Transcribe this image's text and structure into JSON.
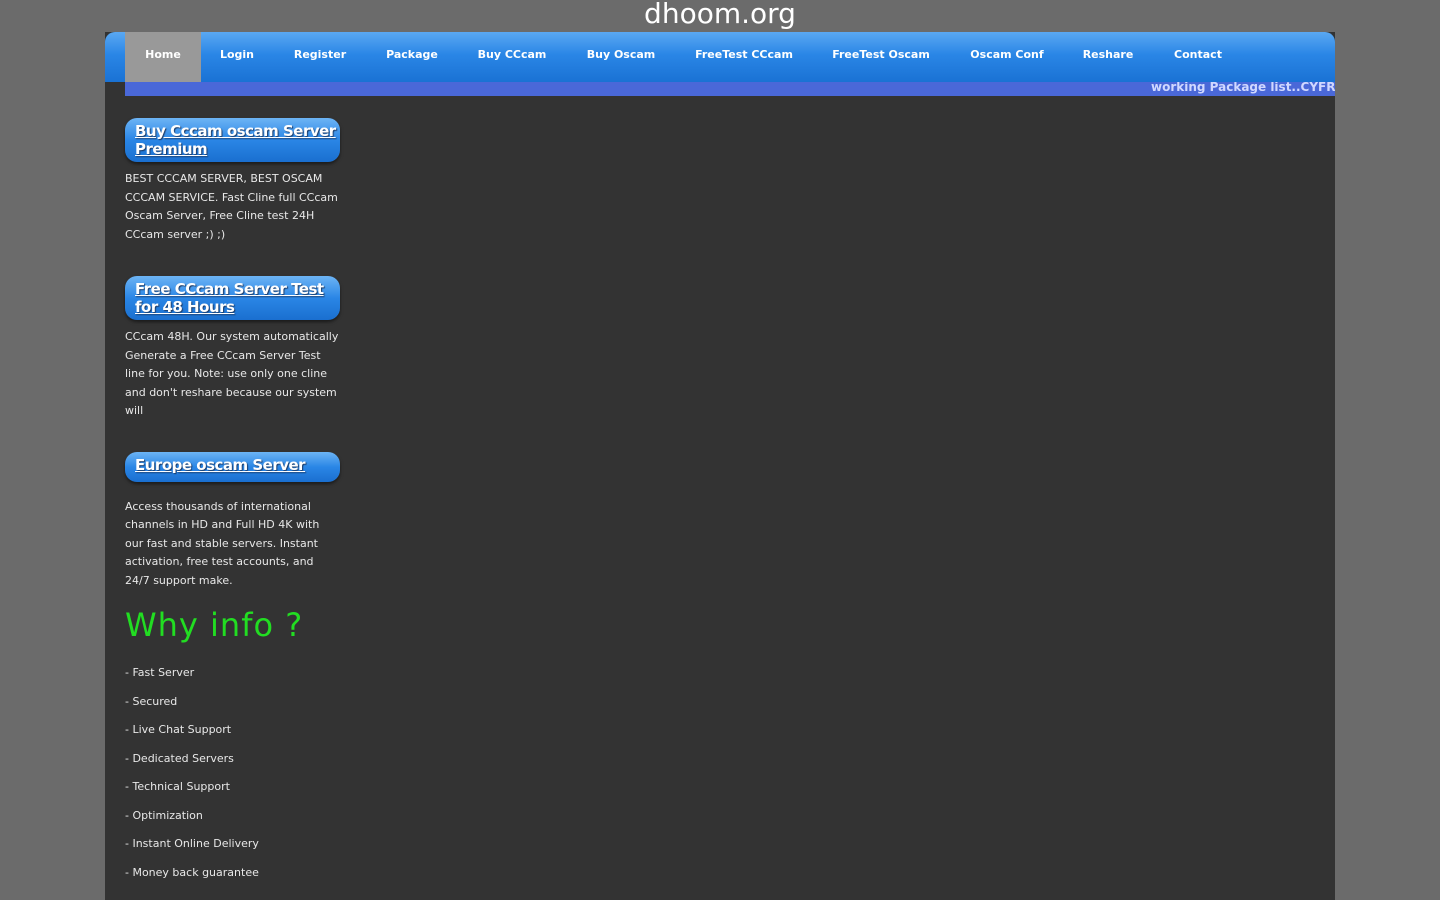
{
  "site": {
    "title": "dhoom.org"
  },
  "nav": {
    "items": [
      {
        "label": "Home",
        "active": true
      },
      {
        "label": "Login"
      },
      {
        "label": "Register"
      },
      {
        "label": "Package"
      },
      {
        "label": "Buy CCcam"
      },
      {
        "label": "Buy Oscam"
      },
      {
        "label": "FreeTest CCcam"
      },
      {
        "label": "FreeTest Oscam"
      },
      {
        "label": "Oscam Conf"
      },
      {
        "label": "Reshare"
      },
      {
        "label": "Contact"
      }
    ]
  },
  "ticker": {
    "text": "working Package list..CYFR"
  },
  "sidebar": {
    "boxes": [
      {
        "title": "Buy Cccam oscam Server Premium",
        "desc": "BEST CCCAM SERVER, BEST OSCAM CCCAM SERVICE. Fast Cline full CCcam Oscam Server, Free Cline test 24H CCcam server ;) ;)"
      },
      {
        "title": "Free CCcam Server Test for 48 Hours",
        "desc": "CCcam 48H. Our system automatically Generate a Free CCcam Server Test line for you. Note: use only one cline and don't reshare because our system will"
      },
      {
        "title": "Europe oscam Server",
        "desc": "Access thousands of international channels in HD and Full HD 4K with our fast and stable servers. Instant activation, free test accounts, and 24/7 support make."
      }
    ]
  },
  "why": {
    "heading": "Why info ?",
    "items": [
      "- Fast Server",
      "- Secured",
      "- Live Chat Support",
      "- Dedicated Servers",
      "- Technical Support",
      "- Optimization",
      "- Instant Online Delivery",
      "- Money back guarantee"
    ]
  },
  "colors": {
    "page_bg": "#6b6b6b",
    "frame_bg": "#333333",
    "nav_blue": "#2a86e6",
    "ticker_bg": "#4a68d8",
    "why_heading": "#22dd22"
  }
}
